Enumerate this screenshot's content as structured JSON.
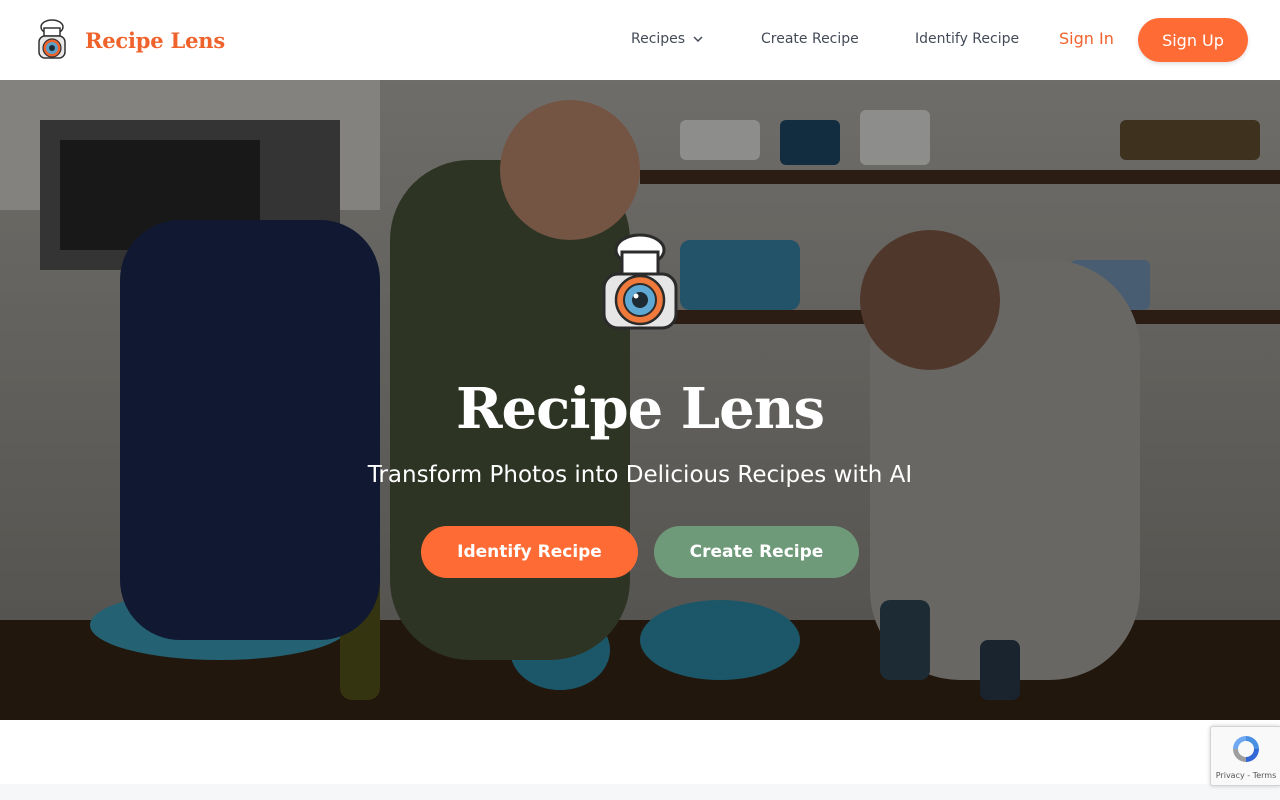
{
  "brand": {
    "name": "Recipe Lens",
    "color": "#f0622b"
  },
  "nav": {
    "recipes_label": "Recipes",
    "create_label": "Create Recipe",
    "identify_label": "Identify Recipe"
  },
  "auth": {
    "signin_label": "Sign In",
    "signup_label": "Sign Up"
  },
  "hero": {
    "title": "Recipe Lens",
    "subtitle": "Transform Photos into Delicious Recipes with AI",
    "identify_button": "Identify Recipe",
    "create_button": "Create Recipe",
    "background": "kitchen-photo"
  },
  "recaptcha": {
    "links": "Privacy - Terms"
  },
  "colors": {
    "accent": "#ff6b35",
    "secondary": "#6f9a7a",
    "nav_text": "#444b57"
  },
  "icons": [
    "chef-camera-logo-icon",
    "chevron-down-icon",
    "recaptcha-icon"
  ]
}
